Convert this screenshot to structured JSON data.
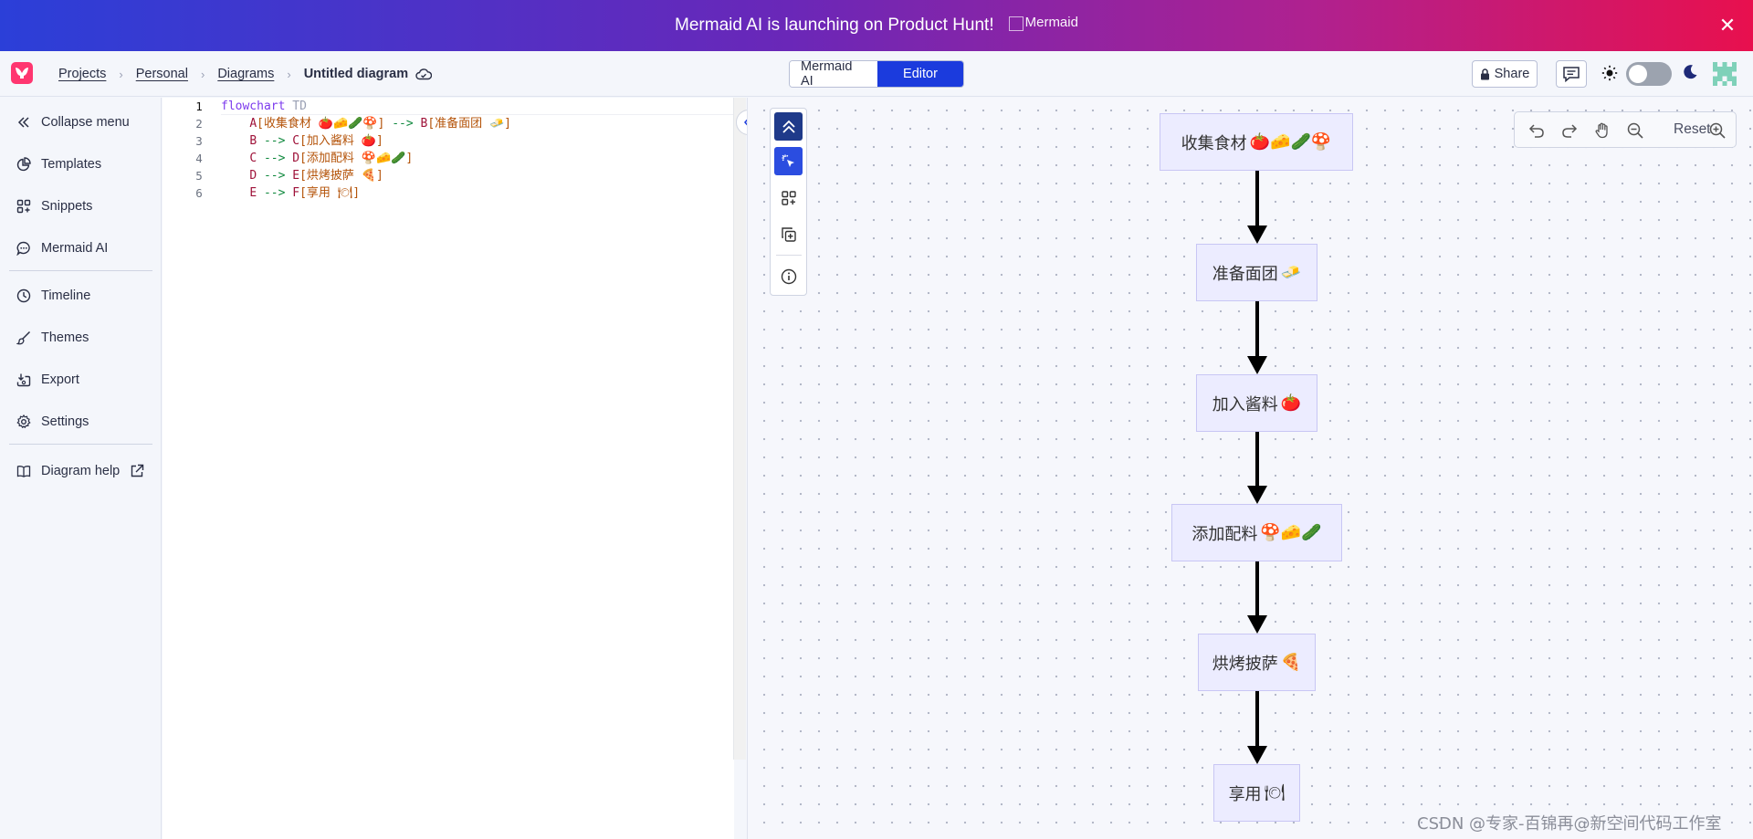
{
  "banner": {
    "text": "Mermaid AI is launching on Product Hunt!",
    "logo_alt": "Mermaid"
  },
  "breadcrumb": {
    "projects": "Projects",
    "personal": "Personal",
    "diagrams": "Diagrams",
    "current": "Untitled diagram",
    "sep": "›"
  },
  "mode": {
    "ai": "Mermaid AI",
    "editor": "Editor"
  },
  "header": {
    "share": "Share"
  },
  "sidebar": {
    "items": [
      {
        "label": "Collapse menu"
      },
      {
        "label": "Templates"
      },
      {
        "label": "Snippets"
      },
      {
        "label": "Mermaid AI"
      },
      {
        "label": "Timeline"
      },
      {
        "label": "Themes"
      },
      {
        "label": "Export"
      },
      {
        "label": "Settings"
      },
      {
        "label": "Diagram help"
      }
    ]
  },
  "editor": {
    "line_numbers": [
      "1",
      "2",
      "3",
      "4",
      "5",
      "6"
    ],
    "line1": {
      "kw": "flowchart",
      "dir": "TD"
    },
    "line2": {
      "a": "A",
      "a_text": "[收集食材 🍅🧀🥒🍄]",
      "arrow": " --> ",
      "b": "B",
      "b_text": "[准备面团 🧈]"
    },
    "line3": {
      "a": "B",
      "arrow": " --> ",
      "b": "C",
      "b_text": "[加入酱料 🍅]"
    },
    "line4": {
      "a": "C",
      "arrow": " --> ",
      "b": "D",
      "b_text": "[添加配料 🍄🧀🥒]"
    },
    "line5": {
      "a": "D",
      "arrow": " --> ",
      "b": "E",
      "b_text": "[烘烤披萨 🍕]"
    },
    "line6": {
      "a": "E",
      "arrow": " --> ",
      "b": "F",
      "b_text": "[享用 🍽]"
    }
  },
  "zoom": {
    "reset": "Reset"
  },
  "diagram": {
    "nodes": [
      {
        "id": "A",
        "text": "收集食材",
        "emoji": "🍅🧀🥒🍄"
      },
      {
        "id": "B",
        "text": "准备面团",
        "emoji": "🧈"
      },
      {
        "id": "C",
        "text": "加入酱料",
        "emoji": "🍅"
      },
      {
        "id": "D",
        "text": "添加配料",
        "emoji": "🍄🧀🥒"
      },
      {
        "id": "E",
        "text": "烘烤披萨",
        "emoji": "🍕"
      },
      {
        "id": "F",
        "text": "享用",
        "emoji": "🍽"
      }
    ]
  },
  "watermark": "CSDN @专家-百锦再@新空间代码工作室",
  "colors": {
    "accent": "#1b3bdd",
    "node_fill": "#ececff",
    "node_border": "#c8c6f4",
    "logo": "#ff3670"
  }
}
